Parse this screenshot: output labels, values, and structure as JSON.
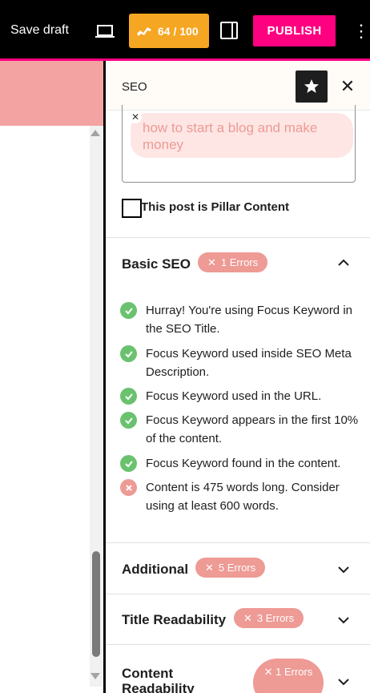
{
  "toolbar": {
    "save_draft": "Save draft",
    "seo_score": "64 / 100",
    "publish": "PUBLISH"
  },
  "sidebar": {
    "title": "SEO",
    "focus_keyword": "how to start a blog and make money",
    "pillar_label": "This post is Pillar Content",
    "sections": {
      "basic": {
        "title": "Basic SEO",
        "errors": "1 Errors",
        "checks": [
          {
            "status": "ok",
            "text": "Hurray! You're using Focus Keyword in the SEO Title."
          },
          {
            "status": "ok",
            "text": "Focus Keyword used inside SEO Meta Description."
          },
          {
            "status": "ok",
            "text": "Focus Keyword used in the URL."
          },
          {
            "status": "ok",
            "text": "Focus Keyword appears in the first 10% of the content."
          },
          {
            "status": "ok",
            "text": "Focus Keyword found in the content."
          },
          {
            "status": "error",
            "text": "Content is 475 words long. Consider using at least 600 words."
          }
        ]
      },
      "additional": {
        "title": "Additional",
        "errors": "5 Errors"
      },
      "title_readability": {
        "title": "Title Readability",
        "errors": "3 Errors"
      },
      "content_readability": {
        "title": "Content Readability",
        "errors": "1 Errors"
      }
    }
  },
  "colors": {
    "publish": "#ff0080",
    "score": "#f5a623",
    "ok": "#6ac26f",
    "error": "#ee9a95"
  }
}
